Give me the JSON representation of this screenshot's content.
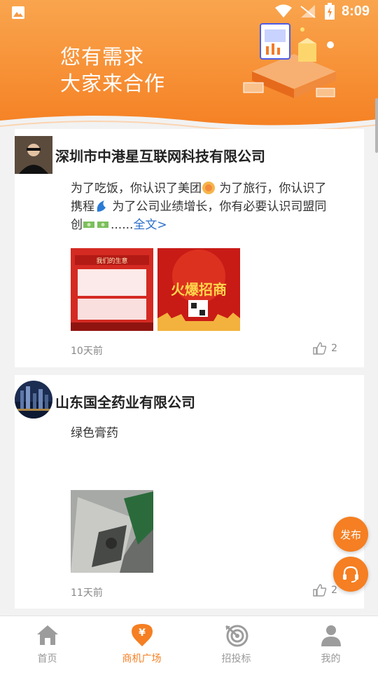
{
  "status_bar": {
    "time": "8:09",
    "icons": [
      "gallery-icon",
      "wifi-icon",
      "no-signal-icon",
      "battery-charging-icon"
    ]
  },
  "banner": {
    "line1": "您有需求",
    "line2": "大家来合作"
  },
  "posts": [
    {
      "company": "深圳市中港星互联网科技有限公司",
      "text_parts": [
        "为了吃饭，你认识了美团",
        "为了旅行，你认识了携程",
        "为了公司业绩增长，你有必要认识司盟同创",
        "......"
      ],
      "more": "全文>",
      "emojis": [
        "meituan-emoji",
        "ctrip-emoji",
        "money-emoji",
        "money-emoji"
      ],
      "images": [
        "我们的生意",
        "火爆招商"
      ],
      "time_ago": "10天前",
      "likes": "2"
    },
    {
      "company": "山东国全药业有限公司",
      "text": "绿色膏药",
      "images": [
        "machine-photo"
      ],
      "time_ago": "11天前",
      "likes": "2"
    }
  ],
  "fab": {
    "publish": "发布",
    "service": "headset-icon"
  },
  "nav": [
    {
      "label": "首页",
      "icon": "home-icon",
      "active": false
    },
    {
      "label": "商机广场",
      "icon": "yuan-pin-icon",
      "active": true
    },
    {
      "label": "招投标",
      "icon": "target-icon",
      "active": false
    },
    {
      "label": "我的",
      "icon": "user-icon",
      "active": false
    }
  ],
  "colors": {
    "accent": "#f57f22",
    "link": "#2c6fc9",
    "muted": "#888888"
  }
}
